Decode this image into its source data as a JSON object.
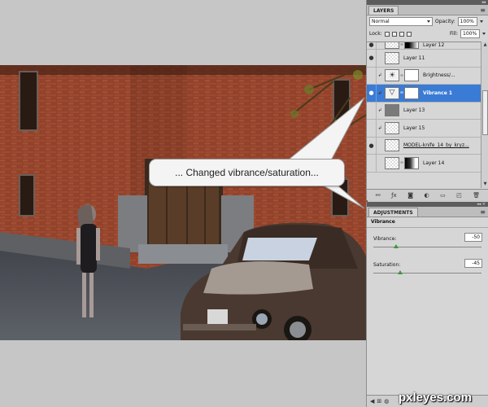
{
  "layers_panel": {
    "tab_label": "LAYERS",
    "blend_mode": "Normal",
    "opacity_label": "Opacity:",
    "opacity_value": "100%",
    "lock_label": "Lock:",
    "fill_label": "Fill:",
    "fill_value": "100%",
    "layers": [
      {
        "name": "Layer 12",
        "visible": true
      },
      {
        "name": "Layer 11",
        "visible": true
      },
      {
        "name": "Brightness/...",
        "visible": false
      },
      {
        "name": "Vibrance 1",
        "visible": true,
        "selected": true
      },
      {
        "name": "Layer 13",
        "visible": false
      },
      {
        "name": "Layer 15",
        "visible": false
      },
      {
        "name": "MODEL-knife_14_by_kryz...",
        "visible": true
      },
      {
        "name": "Layer 14",
        "visible": false
      }
    ]
  },
  "adjustments_panel": {
    "tab_label": "ADJUSTMENTS",
    "title": "Vibrance",
    "vibrance_label": "Vibrance:",
    "vibrance_value": "-50",
    "saturation_label": "Saturation:",
    "saturation_value": "-45"
  },
  "callout_text": "... Changed vibrance/saturation...",
  "watermark": "pxleyes.com",
  "colors": {
    "selected_layer": "#3a7bd5",
    "panel_bg": "#d6d6d6",
    "slider_handle": "#3a9a3a"
  },
  "icons": {
    "eye": "eye-icon",
    "chain": "chain-link-icon",
    "panel_menu": "panel-menu-icon"
  }
}
